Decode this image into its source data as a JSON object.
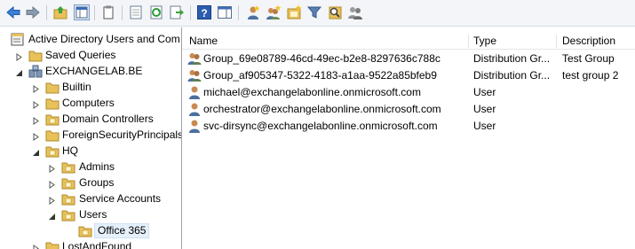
{
  "toolbar": {
    "buttons": [
      "back-icon",
      "forward-icon",
      "up-folder-icon",
      "show-console-tree-icon",
      "delete-icon",
      "properties-icon",
      "refresh-icon",
      "export-list-icon",
      "help-icon",
      "show-hide-action-pane-icon",
      "create-user-icon",
      "create-group-icon",
      "create-ou-icon",
      "filter-icon",
      "find-icon",
      "add-to-group-icon"
    ]
  },
  "tree": {
    "items": [
      {
        "label": "Active Directory Users and Com",
        "icon": "console-root-icon"
      },
      {
        "label": "Saved Queries",
        "icon": "folder-icon"
      },
      {
        "label": "EXCHANGELAB.BE",
        "icon": "domain-icon"
      },
      {
        "label": "Builtin",
        "icon": "folder-icon"
      },
      {
        "label": "Computers",
        "icon": "folder-icon"
      },
      {
        "label": "Domain Controllers",
        "icon": "ou-icon"
      },
      {
        "label": "ForeignSecurityPrincipals",
        "icon": "folder-icon"
      },
      {
        "label": "HQ",
        "icon": "ou-icon"
      },
      {
        "label": "Admins",
        "icon": "ou-icon"
      },
      {
        "label": "Groups",
        "icon": "ou-icon"
      },
      {
        "label": "Service Accounts",
        "icon": "ou-icon"
      },
      {
        "label": "Users",
        "icon": "ou-icon"
      },
      {
        "label": "Office 365",
        "icon": "ou-icon"
      },
      {
        "label": "LostAndFound",
        "icon": "folder-icon"
      }
    ]
  },
  "list": {
    "columns": [
      "Name",
      "Type",
      "Description"
    ],
    "rows": [
      {
        "name": "Group_69e08789-46cd-49ec-b2e8-8297636c788c",
        "type": "Distribution Gr...",
        "description": "Test Group",
        "icon": "group-icon"
      },
      {
        "name": "Group_af905347-5322-4183-a1aa-9522a85bfeb9",
        "type": "Distribution Gr...",
        "description": "test group 2",
        "icon": "group-icon"
      },
      {
        "name": "michael@exchangelabonline.onmicrosoft.com",
        "type": "User",
        "description": "",
        "icon": "user-icon"
      },
      {
        "name": "orchestrator@exchangelabonline.onmicrosoft.com",
        "type": "User",
        "description": "",
        "icon": "user-icon"
      },
      {
        "name": "svc-dirsync@exchangelabonline.onmicrosoft.com",
        "type": "User",
        "description": "",
        "icon": "user-icon"
      }
    ]
  },
  "colors": {
    "folder": "#e8c15a",
    "selection": "#e5f0fb",
    "accent": "#2a6ac8"
  }
}
